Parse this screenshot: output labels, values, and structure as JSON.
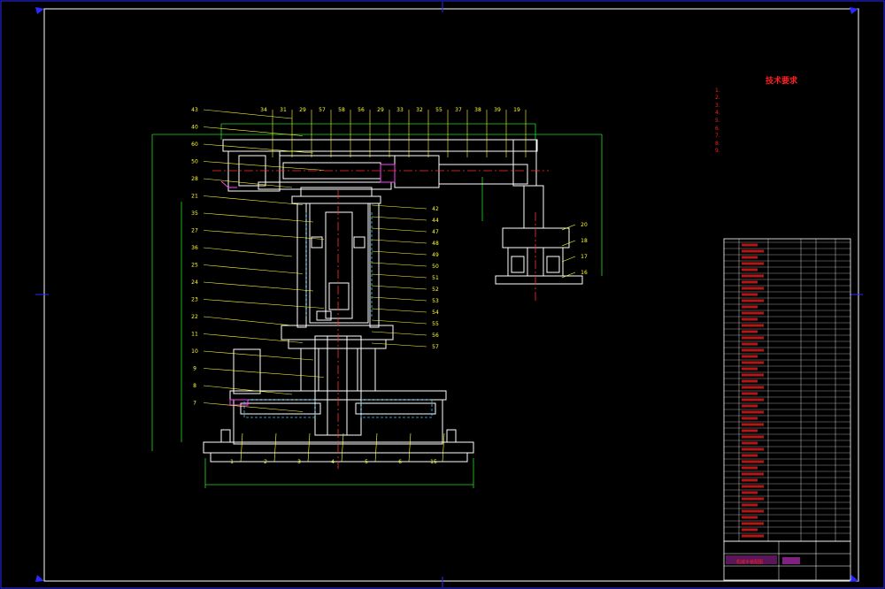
{
  "drawing": {
    "tech_requirements_title": "技术要求",
    "tech_requirements_lines": [
      "1.",
      "2.",
      "3.",
      "4.",
      "5.",
      "6.",
      "7.",
      "8.",
      "9."
    ],
    "title_block_name": "机械手装配图"
  },
  "balloons_left": [
    "43",
    "40",
    "60",
    "50",
    "28",
    "21",
    "35",
    "27",
    "36",
    "25",
    "24",
    "23",
    "22",
    "11",
    "10",
    "9",
    "8",
    "7"
  ],
  "balloons_top": [
    "34",
    "31",
    "29",
    "57",
    "58",
    "56",
    "29",
    "33",
    "32",
    "55",
    "37",
    "38",
    "39",
    "19"
  ],
  "balloons_right": [
    "42",
    "44",
    "47",
    "48",
    "49",
    "50",
    "51",
    "52",
    "53",
    "54",
    "55",
    "56",
    "57"
  ],
  "balloons_bottom": [
    "1",
    "2",
    "3",
    "4",
    "5",
    "6",
    "15"
  ],
  "balloons_fixture": [
    "20",
    "18",
    "17",
    "16"
  ],
  "colors": {
    "frame": "#ffffff",
    "border_blue": "#2a2aff",
    "part_outline": "#ffffff",
    "dimension": "#22dd22",
    "leader": "#ffff33",
    "centerline": "#ff3030",
    "hidden": "#33ccff",
    "annotation": "#ff2020",
    "magenta": "#ff40ff"
  }
}
